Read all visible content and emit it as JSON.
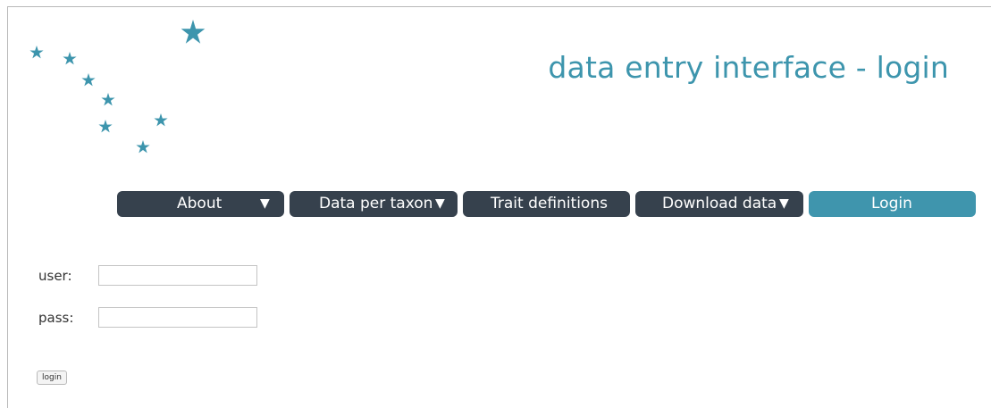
{
  "header": {
    "title": "data entry interface - login",
    "logo_icon": "star-cluster-icon",
    "brand_color": "#3d95ad"
  },
  "nav": {
    "items": [
      {
        "label": "About",
        "has_dropdown": true,
        "icon": "caret-down-icon"
      },
      {
        "label": "Data per taxon",
        "has_dropdown": true,
        "icon": "caret-down-icon"
      },
      {
        "label": "Trait definitions",
        "has_dropdown": false
      },
      {
        "label": "Download data",
        "has_dropdown": true,
        "icon": "caret-down-icon"
      },
      {
        "label": "Login",
        "has_dropdown": false,
        "active": true
      }
    ],
    "caret_glyph": "▼",
    "colors": {
      "default": "#36414d",
      "active": "#3f95ad"
    }
  },
  "form": {
    "user_label": "user:",
    "user_value": "",
    "pass_label": "pass:",
    "pass_value": "",
    "submit_label": "login"
  }
}
